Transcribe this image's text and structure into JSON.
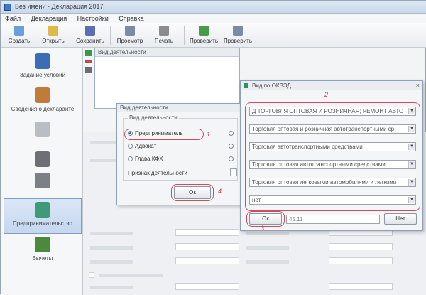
{
  "window": {
    "title": "Без имени - Декларация 2017"
  },
  "menu": [
    "Файл",
    "Декларация",
    "Настройки",
    "Справка"
  ],
  "toolbar": {
    "buttons": [
      {
        "label": "Создать",
        "icon": "new-document-icon",
        "color": "#6a9fd8"
      },
      {
        "label": "Открыть",
        "icon": "folder-open-icon",
        "color": "#e0b94a"
      },
      {
        "label": "Сохранить",
        "icon": "save-icon",
        "color": "#5a6fb0"
      },
      {
        "label": "Просмотр",
        "icon": "preview-icon",
        "color": "#7a8ca3"
      },
      {
        "label": "Печать",
        "icon": "printer-icon",
        "color": "#8c8c8c"
      },
      {
        "label": "Проверить",
        "icon": "check-icon",
        "color": "#4a9a4a"
      },
      {
        "label": "Проверить",
        "icon": "report-icon",
        "color": "#7a8ca3"
      }
    ]
  },
  "sidebar": {
    "items": [
      {
        "label": "Задание условий",
        "icon": "tree-icon",
        "color": "#3a6db5"
      },
      {
        "label": "Сведения о декларанте",
        "icon": "person-icon",
        "color": "#c07a3a"
      },
      {
        "label": "",
        "icon": "people-icon",
        "color": "#b9bdc4"
      },
      {
        "label": "",
        "icon": "user-gear-icon",
        "color": "#6d6f75"
      },
      {
        "label": "",
        "icon": "money-bag-icon",
        "color": "#7d7f86"
      },
      {
        "label": "Предпринимательство",
        "icon": "business-icon",
        "color": "#3f9a7a"
      },
      {
        "label": "Вычеты",
        "icon": "deductions-icon",
        "color": "#4a8a3a"
      }
    ]
  },
  "main_panel": {
    "header": "Вид деятельности"
  },
  "dialog_activity": {
    "title": "Вид деятельности",
    "group_label": "Вид деятельности",
    "options": [
      {
        "label": "Предприниматель",
        "checked": true
      },
      {
        "label": "Адвокат",
        "checked": false
      },
      {
        "label": "Глава КФХ",
        "checked": false
      }
    ],
    "activity_label": "Признак деятельности",
    "ok_label": "Ок",
    "marker": "1"
  },
  "dialog_okved": {
    "title": "Вид по ОКВЭД",
    "close": "×",
    "combos": [
      "Д ТОРГОВЛЯ ОПТОВАЯ И РОЗНИЧНАЯ; РЕМОНТ АВТО",
      "Торговля оптовая и розничная автотранспортными ср",
      "Торговля автотранспортными средствами",
      "Торговля оптовая автотранспортными средствами",
      "Торговля оптовая легковыми автомобилями и легкими",
      "нет"
    ],
    "ok_label": "Ок",
    "code_input": "45.11",
    "cancel_label": "Нет",
    "marker_combos": "2",
    "marker_ok": "3"
  },
  "colors": {
    "highlight": "#d04b5e",
    "accent": "#3a79c9"
  }
}
